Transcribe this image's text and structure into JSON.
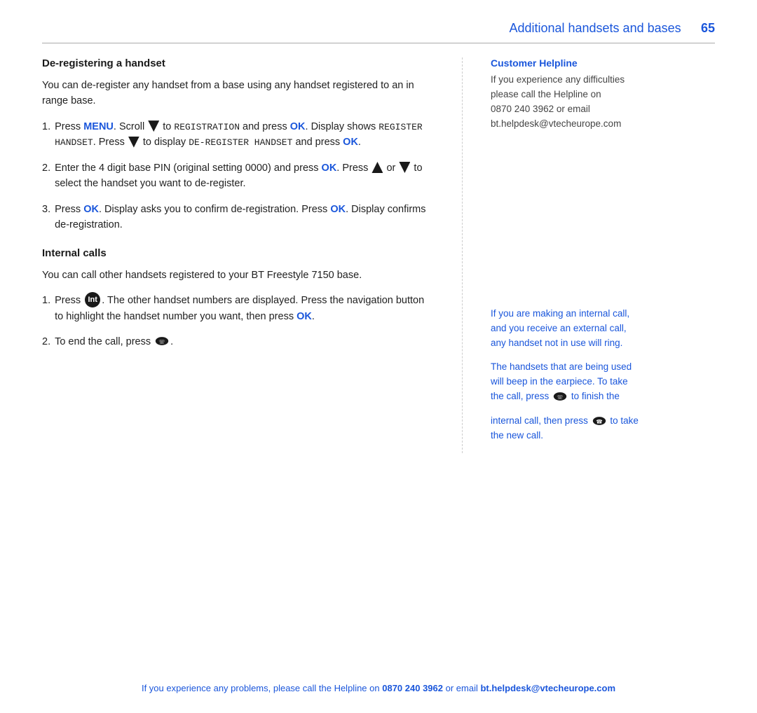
{
  "header": {
    "title": "Additional handsets and bases",
    "page_number": "65"
  },
  "left_column": {
    "section1": {
      "heading": "De-registering a handset",
      "intro": "You can de-register any handset from a base using any handset registered to an in range base.",
      "steps": [
        {
          "num": "1.",
          "parts": [
            {
              "text": "Press ",
              "type": "normal"
            },
            {
              "text": "MENU",
              "type": "blue-bold"
            },
            {
              "text": ". Scroll ",
              "type": "normal"
            },
            {
              "text": "▼",
              "type": "arrow-down"
            },
            {
              "text": " to ",
              "type": "normal"
            },
            {
              "text": "REGISTRATION",
              "type": "mono"
            },
            {
              "text": " and press ",
              "type": "normal"
            },
            {
              "text": "OK",
              "type": "blue-bold"
            },
            {
              "text": ". Display shows ",
              "type": "normal"
            },
            {
              "text": "REGISTER HANDSET",
              "type": "mono"
            },
            {
              "text": ". Press ",
              "type": "normal"
            },
            {
              "text": "▼",
              "type": "arrow-down"
            },
            {
              "text": " to display ",
              "type": "normal"
            },
            {
              "text": "DE-REGISTER HANDSET",
              "type": "mono"
            },
            {
              "text": " and press ",
              "type": "normal"
            },
            {
              "text": "OK",
              "type": "blue-bold"
            },
            {
              "text": ".",
              "type": "normal"
            }
          ]
        },
        {
          "num": "2.",
          "parts": [
            {
              "text": "Enter the 4 digit base PIN (original setting 0000) and press ",
              "type": "normal"
            },
            {
              "text": "OK",
              "type": "blue-bold"
            },
            {
              "text": ". Press ",
              "type": "normal"
            },
            {
              "text": "▲",
              "type": "arrow-up"
            },
            {
              "text": " or ",
              "type": "normal"
            },
            {
              "text": "▼",
              "type": "arrow-down"
            },
            {
              "text": " to select the handset you want to de-register.",
              "type": "normal"
            }
          ]
        },
        {
          "num": "3.",
          "parts": [
            {
              "text": "Press ",
              "type": "normal"
            },
            {
              "text": "OK",
              "type": "blue-bold"
            },
            {
              "text": ". Display asks you to confirm de-registration. Press ",
              "type": "normal"
            },
            {
              "text": "OK",
              "type": "blue-bold"
            },
            {
              "text": ". Display confirms de-registration.",
              "type": "normal"
            }
          ]
        }
      ]
    },
    "section2": {
      "heading": "Internal calls",
      "intro": "You can call other handsets registered to your BT Freestyle 7150 base.",
      "steps": [
        {
          "num": "1.",
          "parts": [
            {
              "text": "Press ",
              "type": "normal"
            },
            {
              "text": "Int",
              "type": "int-btn"
            },
            {
              "text": ". The other handset numbers are displayed. Press the navigation button to highlight the handset number you want, then press ",
              "type": "normal"
            },
            {
              "text": "OK",
              "type": "blue-bold"
            },
            {
              "text": ".",
              "type": "normal"
            }
          ]
        },
        {
          "num": "2.",
          "parts": [
            {
              "text": "To end the call, press ",
              "type": "normal"
            },
            {
              "text": "end-call",
              "type": "end-call-icon"
            },
            {
              "text": ".",
              "type": "normal"
            }
          ]
        }
      ]
    }
  },
  "right_column": {
    "helpline_box": {
      "title": "Customer Helpline",
      "line1": "If you experience any difficulties",
      "line2": "please call the Helpline on",
      "line3": "0870 240 3962 or email",
      "line4": "bt.helpdesk@vtecheurope.com"
    },
    "note1": {
      "line1": "If you are making an internal call,",
      "line2": "and you receive an external call,",
      "line3": "any handset not in use will ring."
    },
    "note2": {
      "line1": "The handsets that are being used",
      "line2": "will beep in the earpiece. To take",
      "line3": "the call, press",
      "icon": "end-call",
      "line3b": "to finish the"
    },
    "note3": {
      "line1": "internal call, then press",
      "icon": "answer-call",
      "line1b": "to take",
      "line2": "the new call."
    }
  },
  "footer": {
    "prefix": "If you experience any problems, please call the Helpline on ",
    "phone": "0870 240 3962",
    "middle": " or email ",
    "email": "bt.helpdesk@vtecheurope.com"
  }
}
